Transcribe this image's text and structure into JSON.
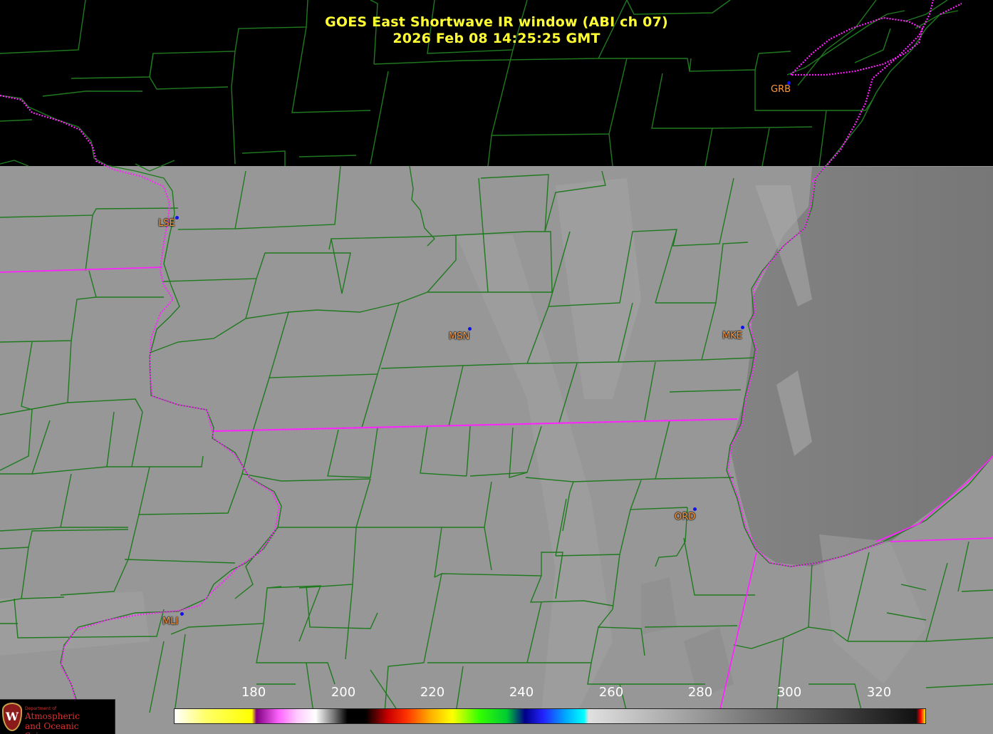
{
  "title": {
    "line1": "GOES East Shortwave IR window (ABI ch 07)",
    "line2": "2026 Feb 08  14:25:25 GMT"
  },
  "stations": [
    {
      "id": "GRB",
      "style": "plain"
    },
    {
      "id": "LSE",
      "style": "boxed"
    },
    {
      "id": "MSN",
      "style": "boxed"
    },
    {
      "id": "MKE",
      "style": "boxed"
    },
    {
      "id": "ORD",
      "style": "boxed"
    },
    {
      "id": "MLI",
      "style": "boxed"
    }
  ],
  "colorbar": {
    "ticks": [
      "180",
      "200",
      "220",
      "240",
      "260",
      "280",
      "300",
      "320"
    ],
    "stops": [
      {
        "value": 163,
        "color": "#ffffff"
      },
      {
        "value": 170,
        "color": "#ffff66"
      },
      {
        "value": 180,
        "color": "#ffff00"
      },
      {
        "value": 181,
        "color": "#800080"
      },
      {
        "value": 186,
        "color": "#ff66ff"
      },
      {
        "value": 190,
        "color": "#ffccff"
      },
      {
        "value": 194,
        "color": "#ffffff"
      },
      {
        "value": 198,
        "color": "#777777"
      },
      {
        "value": 201,
        "color": "#000000"
      },
      {
        "value": 205,
        "color": "#000000"
      },
      {
        "value": 210,
        "color": "#cc0000"
      },
      {
        "value": 214,
        "color": "#ff3300"
      },
      {
        "value": 219,
        "color": "#ffaa00"
      },
      {
        "value": 224,
        "color": "#ffff00"
      },
      {
        "value": 230,
        "color": "#33ff00"
      },
      {
        "value": 236,
        "color": "#00cc33"
      },
      {
        "value": 240,
        "color": "#000088"
      },
      {
        "value": 244,
        "color": "#2222ff"
      },
      {
        "value": 249,
        "color": "#00aaff"
      },
      {
        "value": 253,
        "color": "#00ffff"
      },
      {
        "value": 254,
        "color": "#e0e0e0"
      },
      {
        "value": 290,
        "color": "#777777"
      },
      {
        "value": 326,
        "color": "#111111"
      },
      {
        "value": 327,
        "color": "#ff0000"
      },
      {
        "value": 328,
        "color": "#ffee00"
      }
    ]
  },
  "logo": {
    "dept": "Department of",
    "line1": "Atmospheric",
    "line2": "and Oceanic Sciences",
    "mark": "W"
  },
  "colors": {
    "title": "#ffff33",
    "county_lines": "#1f7a1f",
    "state_lines": "#ff00ff",
    "station_label": "#ff9a3c",
    "station_dot": "#1010ee"
  }
}
